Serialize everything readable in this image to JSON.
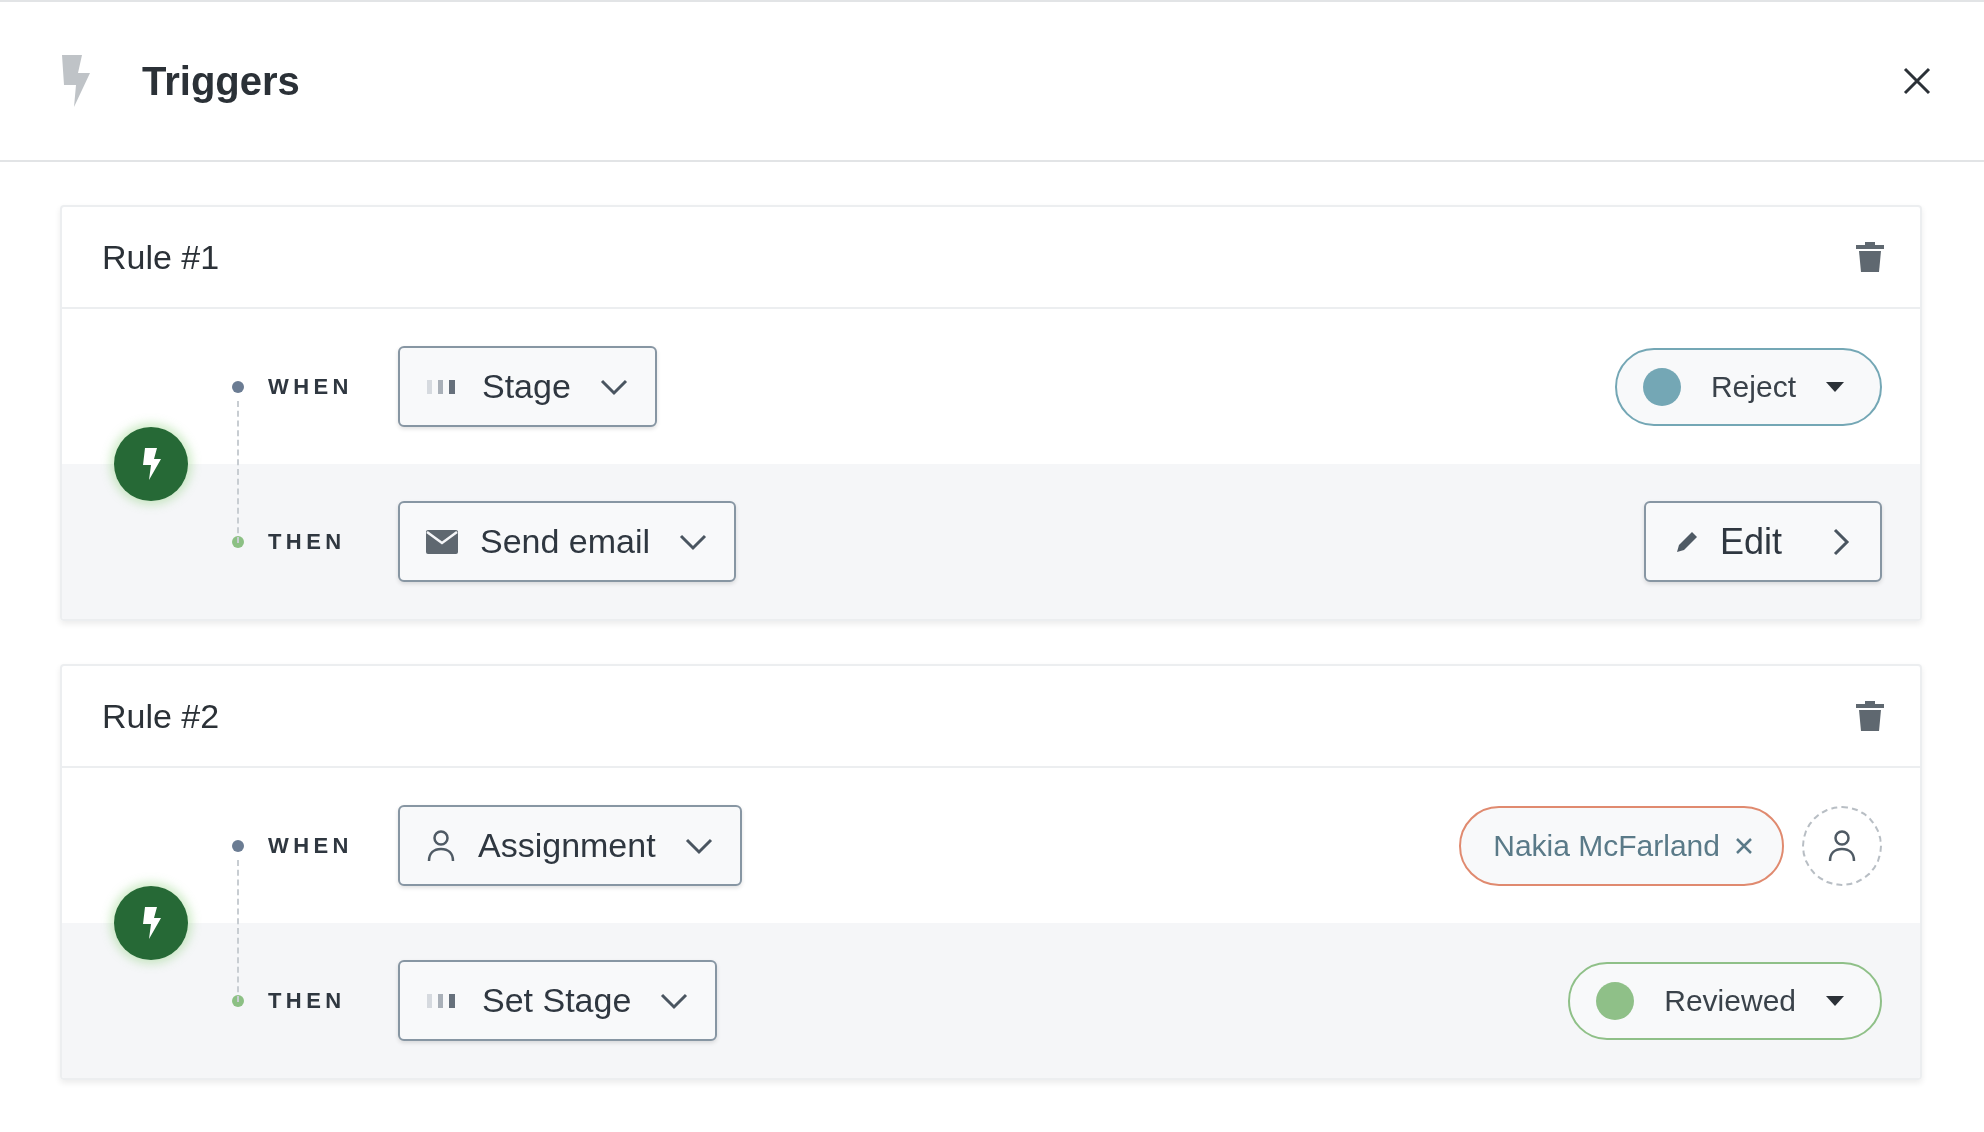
{
  "header": {
    "title": "Triggers"
  },
  "rules": [
    {
      "title": "Rule #1",
      "when": {
        "label": "WHEN",
        "trigger": {
          "kind": "stage",
          "text": "Stage"
        },
        "value": {
          "kind": "status",
          "text": "Reject",
          "color": "#74a7b5"
        }
      },
      "then": {
        "label": "THEN",
        "action": {
          "kind": "email",
          "text": "Send email"
        },
        "value": {
          "kind": "edit",
          "text": "Edit"
        }
      }
    },
    {
      "title": "Rule #2",
      "when": {
        "label": "WHEN",
        "trigger": {
          "kind": "assignment",
          "text": "Assignment"
        },
        "value": {
          "kind": "assignee",
          "text": "Nakia McFarland"
        }
      },
      "then": {
        "label": "THEN",
        "action": {
          "kind": "stage",
          "text": "Set Stage"
        },
        "value": {
          "kind": "status",
          "text": "Reviewed",
          "color": "#8fc088"
        }
      }
    }
  ]
}
